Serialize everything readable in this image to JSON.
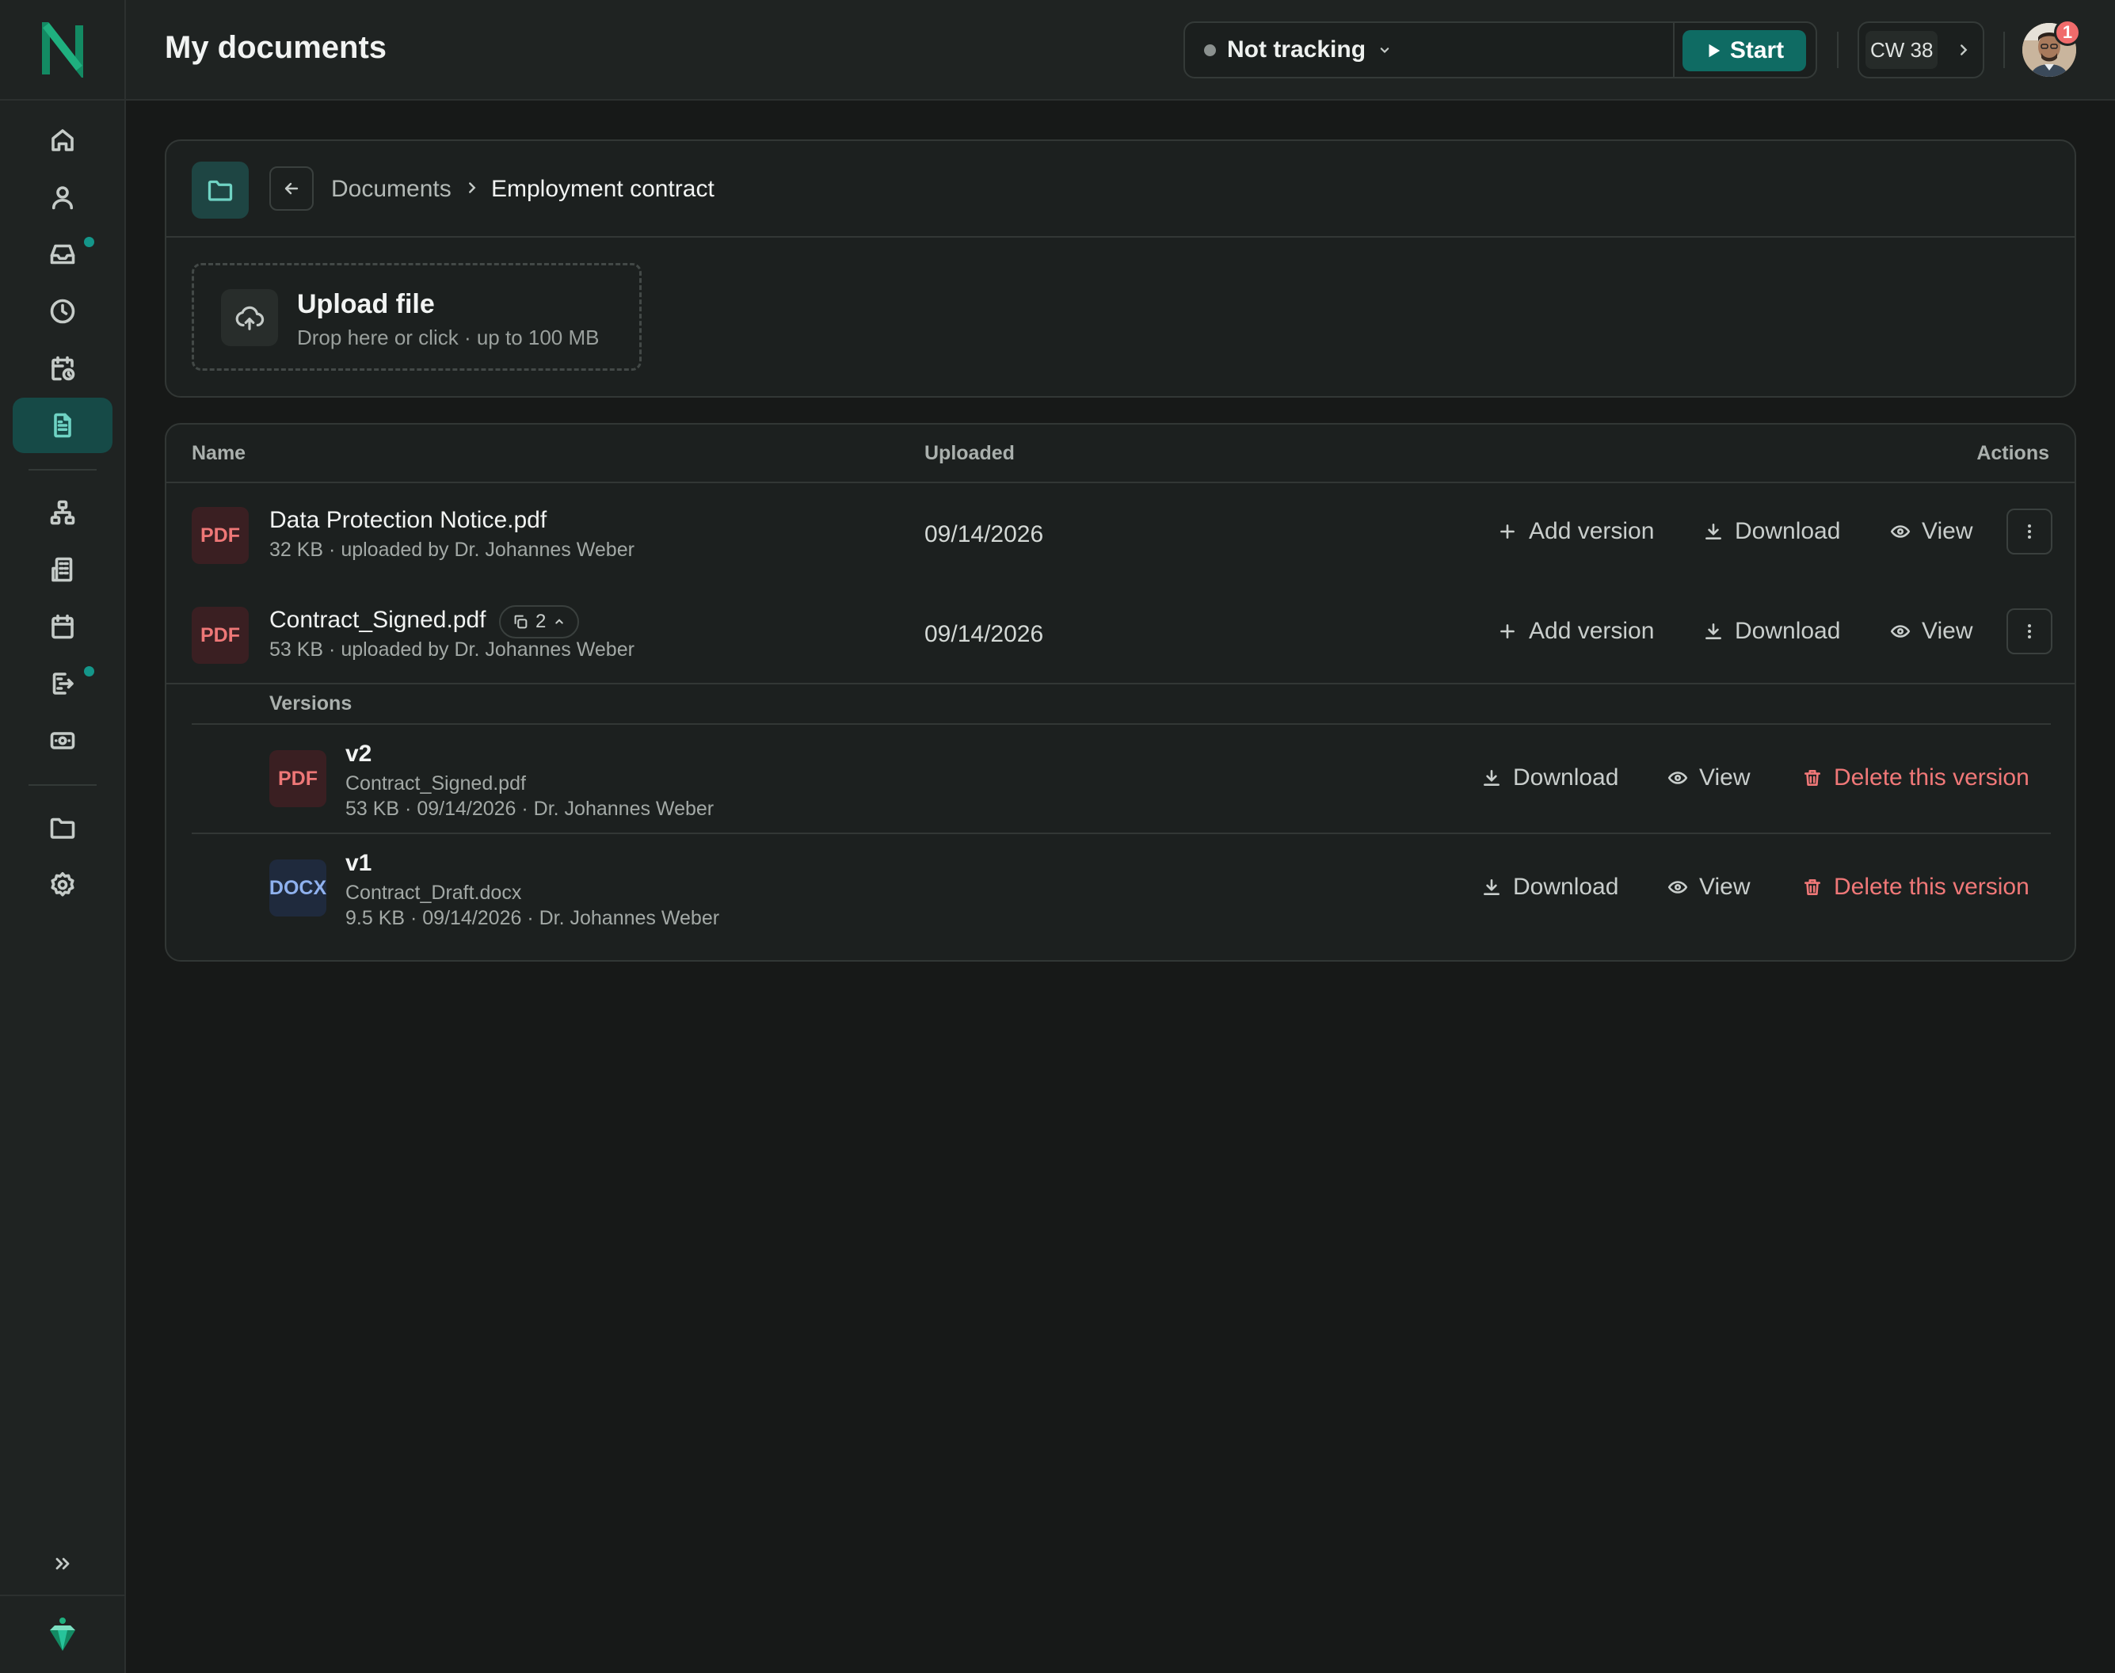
{
  "header": {
    "title": "My documents",
    "tracking_status": "Not tracking",
    "start_label": "Start",
    "week_label": "CW 38",
    "notification_count": "1"
  },
  "sidebar": {
    "items": [
      {
        "name": "home"
      },
      {
        "name": "profile"
      },
      {
        "name": "inbox",
        "dot": true
      },
      {
        "name": "time-tracking"
      },
      {
        "name": "absences"
      },
      {
        "name": "documents",
        "active": true
      },
      {
        "name": "org-chart"
      },
      {
        "name": "company"
      },
      {
        "name": "calendar"
      },
      {
        "name": "requests",
        "dot": true
      },
      {
        "name": "payroll"
      },
      {
        "name": "files"
      },
      {
        "name": "settings"
      }
    ]
  },
  "breadcrumb": {
    "root": "Documents",
    "current": "Employment contract"
  },
  "upload": {
    "title": "Upload file",
    "subtitle": "Drop here or click · up to 100 MB"
  },
  "table": {
    "columns": [
      "Name",
      "Uploaded",
      "Actions"
    ],
    "rows": [
      {
        "type": "PDF",
        "name": "Data Protection Notice.pdf",
        "meta": "32 KB · uploaded by Dr. Johannes Weber",
        "uploaded": "09/14/2026",
        "add_version": "Add version",
        "download": "Download",
        "view": "View"
      },
      {
        "type": "PDF",
        "name": "Contract_Signed.pdf",
        "version_count": "2",
        "meta": "53 KB · uploaded by Dr. Johannes Weber",
        "uploaded": "09/14/2026",
        "add_version": "Add version",
        "download": "Download",
        "view": "View"
      }
    ],
    "versions_label": "Versions",
    "versions": [
      {
        "type": "PDF",
        "title": "v2",
        "file": "Contract_Signed.pdf",
        "meta": "53 KB · 09/14/2026 · Dr. Johannes Weber",
        "download": "Download",
        "view": "View",
        "delete": "Delete this version"
      },
      {
        "type": "DOCX",
        "title": "v1",
        "file": "Contract_Draft.docx",
        "meta": "9.5 KB · 09/14/2026 · Dr. Johannes Weber",
        "download": "Download",
        "view": "View",
        "delete": "Delete this version"
      }
    ]
  },
  "colors": {
    "accent": "#0f6b63",
    "danger": "#f07878",
    "background": "#171918"
  }
}
